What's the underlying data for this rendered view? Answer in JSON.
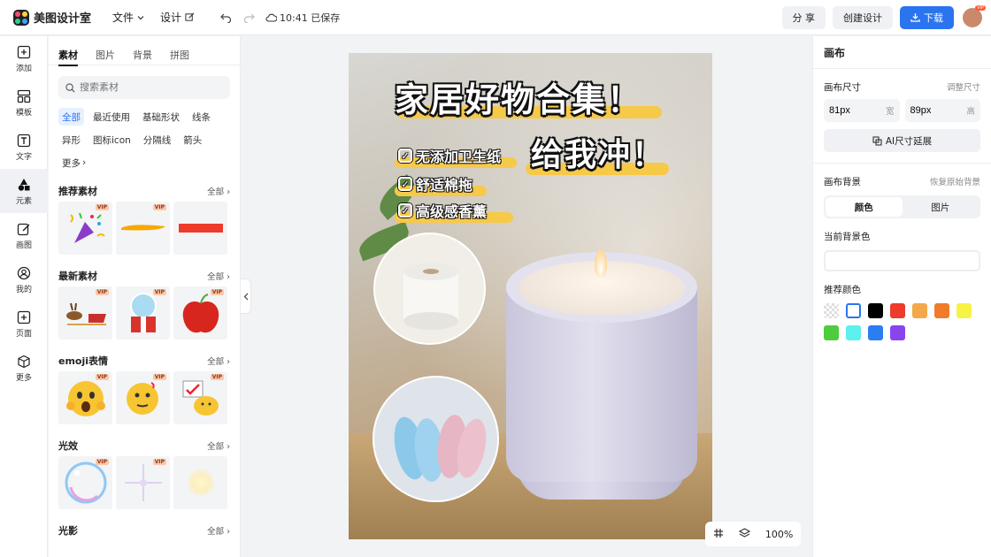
{
  "app": {
    "name": "美图设计室"
  },
  "topbar": {
    "menu": [
      {
        "label": "文件"
      },
      {
        "label": "设计"
      }
    ],
    "save_status": "10:41 已保存",
    "share_label": "分 享",
    "create_label": "创建设计",
    "download_label": "下载",
    "avatar_badge": "VIP"
  },
  "rail": [
    {
      "label": "添加",
      "icon": "plus-square-icon"
    },
    {
      "label": "模板",
      "icon": "template-icon"
    },
    {
      "label": "文字",
      "icon": "text-icon"
    },
    {
      "label": "元素",
      "icon": "shapes-icon",
      "active": true
    },
    {
      "label": "画图",
      "icon": "draw-icon"
    },
    {
      "label": "我的",
      "icon": "user-icon"
    },
    {
      "label": "页面",
      "icon": "add-page-icon"
    },
    {
      "label": "更多",
      "icon": "cube-icon"
    }
  ],
  "panel": {
    "tabs": [
      "素材",
      "图片",
      "背景",
      "拼图"
    ],
    "search_placeholder": "搜索素材",
    "chips": [
      "全部",
      "最近使用",
      "基础形状",
      "线条",
      "异形",
      "图标icon",
      "分隔线",
      "箭头",
      "更多"
    ],
    "all_label": "全部",
    "vip_label": "VIP",
    "sections": {
      "recommended": "推荐素材",
      "latest": "最新素材",
      "emoji": "emoji表情",
      "light": "光效",
      "shadow": "光影"
    }
  },
  "poster": {
    "title": "家居好物合集！",
    "subtitle": "给我冲！",
    "bullets": [
      "无添加卫生纸",
      "舒适棉拖",
      "高级感香薰"
    ]
  },
  "canvas_tools": {
    "zoom": "100%"
  },
  "rpanel": {
    "title": "画布",
    "size_label": "画布尺寸",
    "adjust_size": "调整尺寸",
    "width_value": "81px",
    "width_unit": "宽",
    "height_value": "89px",
    "height_unit": "高",
    "ai_extend": "AI尺寸延展",
    "bg_label": "画布背景",
    "restore_bg": "恢复原始背景",
    "seg_color": "颜色",
    "seg_image": "图片",
    "current_bg": "当前背景色",
    "recommended_colors": "推荐颜色",
    "colors": [
      "transparent",
      "#ffffff",
      "#000000",
      "#ee3b2b",
      "#f4a84a",
      "#f07c2a",
      "#f7f244",
      "#4fcb3e",
      "#5cf0ee",
      "#2b7df2",
      "#8a44ee"
    ]
  }
}
